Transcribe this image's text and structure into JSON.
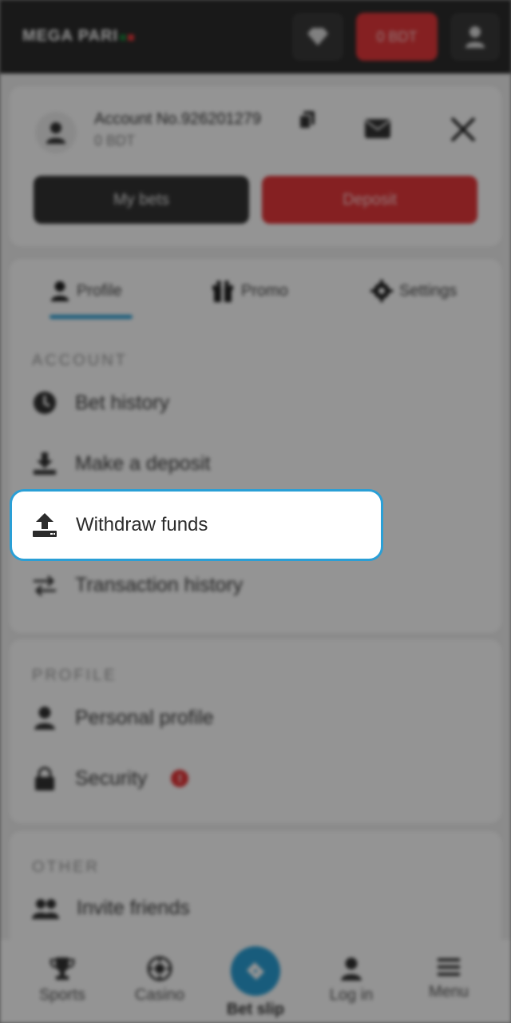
{
  "header": {
    "logo": "MEGA PARI",
    "balance": "0 BDT"
  },
  "account": {
    "number": "Account No.926201279",
    "balance_line": "0 BDT",
    "my_bets_label": "My bets",
    "deposit_label": "Deposit"
  },
  "tabs": [
    {
      "label": "Profile",
      "icon": "person-icon"
    },
    {
      "label": "Promo",
      "icon": "gift-icon"
    },
    {
      "label": "Settings",
      "icon": "gear-icon"
    }
  ],
  "sections": {
    "account": {
      "title": "ACCOUNT",
      "items": [
        {
          "label": "Bet history",
          "icon": "clock-icon"
        },
        {
          "label": "Make a deposit",
          "icon": "download-icon"
        },
        {
          "label": "Withdraw funds",
          "icon": "upload-icon"
        },
        {
          "label": "Transaction history",
          "icon": "transfer-icon"
        }
      ]
    },
    "profile": {
      "title": "PROFILE",
      "items": [
        {
          "label": "Personal profile",
          "icon": "person-icon"
        },
        {
          "label": "Security",
          "icon": "lock-icon",
          "badge": "!"
        }
      ]
    },
    "other": {
      "title": "OTHER",
      "items": [
        {
          "label": "Invite friends",
          "icon": "people-icon"
        }
      ]
    }
  },
  "bottom_nav": [
    {
      "label": "Sports",
      "icon": "trophy-icon"
    },
    {
      "label": "Casino",
      "icon": "casino-chip-icon"
    },
    {
      "label": "Bet slip",
      "icon": "ticket-icon"
    },
    {
      "label": "Log in",
      "icon": "person-icon"
    },
    {
      "label": "Menu",
      "icon": "hamburger-icon"
    }
  ],
  "colors": {
    "accent": "#2a9fd6",
    "brand_red": "#e5383b",
    "header_bg": "#2b2b2b"
  }
}
